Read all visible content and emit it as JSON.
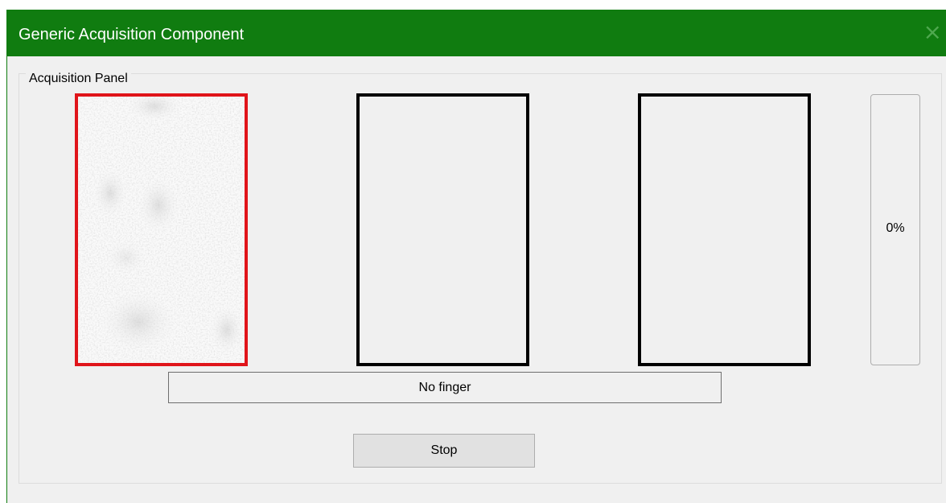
{
  "window": {
    "title": "Generic Acquisition Component",
    "title_bar_color": "#107c10",
    "close_icon": "close-icon"
  },
  "acquisition_panel": {
    "label": "Acquisition Panel",
    "finger_frames": [
      {
        "state": "capturing",
        "border_color": "#e0141a"
      },
      {
        "state": "empty",
        "border_color": "#000000"
      },
      {
        "state": "empty",
        "border_color": "#000000"
      }
    ],
    "progress": {
      "label": "0%",
      "value": 0
    },
    "status": "No finger",
    "stop_button": "Stop"
  }
}
